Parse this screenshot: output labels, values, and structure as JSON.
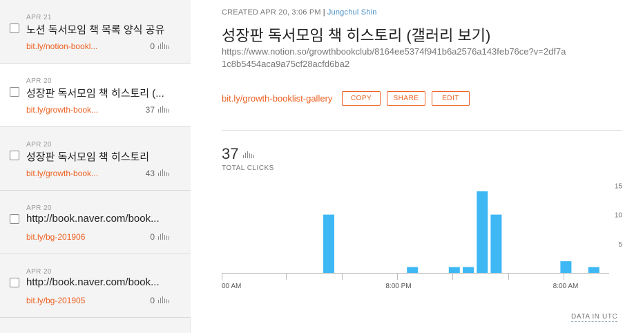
{
  "links": [
    {
      "date": "APR 21",
      "title": "노션 독서모임 책 목록 양식 공유",
      "short": "bit.ly/notion-bookl...",
      "count": "0",
      "selected": false
    },
    {
      "date": "APR 20",
      "title": "성장판 독서모임 책 히스토리 (...",
      "short": "bit.ly/growth-book...",
      "count": "37",
      "selected": true
    },
    {
      "date": "APR 20",
      "title": "성장판 독서모임 책 히스토리",
      "short": "bit.ly/growth-book...",
      "count": "43",
      "selected": false
    },
    {
      "date": "APR 20",
      "title": "http://book.naver.com/book...",
      "short": "bit.ly/bg-201906",
      "count": "0",
      "selected": false
    },
    {
      "date": "APR 20",
      "title": "http://book.naver.com/book...",
      "short": "bit.ly/bg-201905",
      "count": "0",
      "selected": false
    }
  ],
  "detail": {
    "created": "CREATED APR 20, 3:06 PM",
    "separator": "|",
    "author": "Jungchul Shin",
    "title": "성장판 독서모임 책 히스토리 (갤러리 보기)",
    "long_url": "https://www.notion.so/growthbookclub/8164ee5374f941b6a2576a143feb76ce?v=2df7a1c8b5454aca9a75cf28acfd6ba2",
    "short_link": "bit.ly/growth-booklist-gallery",
    "copy_label": "COPY",
    "share_label": "SHARE",
    "edit_label": "EDIT",
    "total_clicks": "37",
    "total_clicks_label": "TOTAL CLICKS",
    "utc_label": "DATA IN UTC"
  },
  "colors": {
    "accent": "#ee6123",
    "bar": "#3db8f5",
    "author": "#4a90c6"
  },
  "icons": {
    "checkbox": "checkbox-icon",
    "mini_chart": "bar-chart-icon"
  },
  "chart_data": {
    "type": "bar",
    "y_ticks": [
      5,
      10,
      15
    ],
    "ylim": [
      0,
      16
    ],
    "x_tick_labels": [
      {
        "label": "00 AM",
        "slot": 0
      },
      {
        "label": "8:00 PM",
        "slot": 12
      },
      {
        "label": "8:00 AM",
        "slot": 24
      }
    ],
    "slot_count": 28,
    "values": [
      0,
      0,
      0,
      0,
      0,
      0,
      0,
      10,
      0,
      0,
      0,
      0,
      0,
      1,
      0,
      0,
      1,
      1,
      14,
      10,
      0,
      0,
      0,
      0,
      2,
      0,
      1,
      0
    ],
    "xlabel": "",
    "ylabel": "",
    "grid": false
  }
}
